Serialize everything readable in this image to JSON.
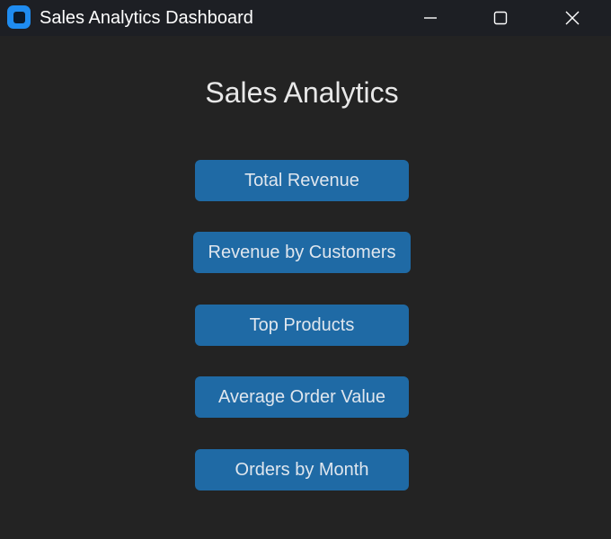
{
  "window": {
    "title": "Sales Analytics Dashboard",
    "controls": {
      "minimize_icon": "minimize-icon",
      "maximize_icon": "maximize-icon",
      "close_icon": "close-icon"
    }
  },
  "main": {
    "heading": "Sales Analytics",
    "buttons": [
      {
        "label": "Total Revenue"
      },
      {
        "label": "Revenue by Customers"
      },
      {
        "label": "Top Products"
      },
      {
        "label": "Average Order Value"
      },
      {
        "label": "Orders by Month"
      }
    ]
  },
  "colors": {
    "background": "#232323",
    "titlebar": "#1d1f24",
    "button": "#1f6aa5",
    "app_icon": "#1f8cf0"
  }
}
